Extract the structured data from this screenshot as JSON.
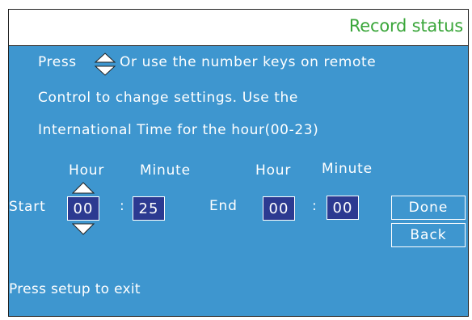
{
  "window": {
    "title": "Record status"
  },
  "instructions": {
    "line1_prefix": "Press",
    "line1_suffix": "Or use  the number keys on remote",
    "line2": "Control  to change settings. Use the",
    "line3": "International Time for the hour(00-23)"
  },
  "schedule": {
    "start_label": "Start",
    "end_label": "End",
    "hour_header": "Hour",
    "minute_header": "Minute",
    "separator": ":",
    "start_hour": "00",
    "start_minute": "25",
    "end_hour": "00",
    "end_minute": "00"
  },
  "buttons": {
    "done_label": "Done",
    "back_label": "Back"
  },
  "footer": {
    "hint": "Press  setup  to exit"
  },
  "icons": {
    "updown": "up-down-arrows-icon",
    "up": "up-arrow-icon",
    "down": "down-arrow-icon"
  },
  "colors": {
    "panel": "#3e96cf",
    "field": "#2c3a91",
    "title": "#3aa63a"
  }
}
